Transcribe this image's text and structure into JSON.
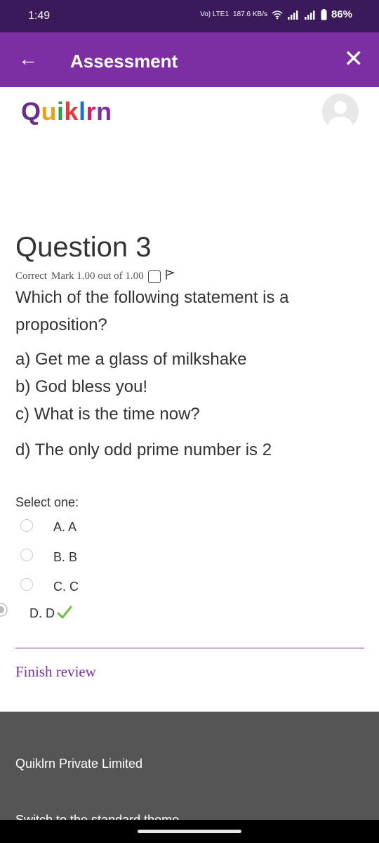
{
  "status_bar": {
    "time": "1:49",
    "network": "Vo) LTE1",
    "speed": "187.6 KB/s",
    "battery": "86%"
  },
  "app_bar": {
    "back_icon": "arrow-left-icon",
    "title": "Assessment",
    "close_icon": "close-icon"
  },
  "header": {
    "logo_text": "Quiklrn",
    "logo_colors": [
      "#6a2c8e",
      "#e8a317",
      "#2a9d4e",
      "#e53935",
      "#1e6fd9",
      "#d81b60",
      "#7b2fa3"
    ],
    "avatar_icon": "user-avatar-icon"
  },
  "question": {
    "title": "Question 3",
    "status": "Correct",
    "mark": "Mark 1.00 out of 1.00",
    "flag_icon": "flag-icon",
    "text": "Which of the following statement is a proposition?",
    "options": [
      "a) Get me a glass of milkshake",
      "b) God bless you!",
      "c) What is the time now?",
      "d) The only odd prime number is 2"
    ]
  },
  "answer": {
    "prompt": "Select one:",
    "choices": [
      "A. A",
      "B. B",
      "C. C",
      "D. D"
    ],
    "selected": "D. D",
    "correct_icon": "checkmark-icon"
  },
  "finish_review": "Finish review",
  "footer": {
    "company": "Quiklrn Private Limited",
    "switch_theme": "Switch to the standard theme"
  },
  "colors": {
    "status_bar": "#3a1a5a",
    "app_bar": "#7b2fa3",
    "link": "#7b2fa3",
    "footer": "#555555",
    "check": "#6abf3c"
  }
}
